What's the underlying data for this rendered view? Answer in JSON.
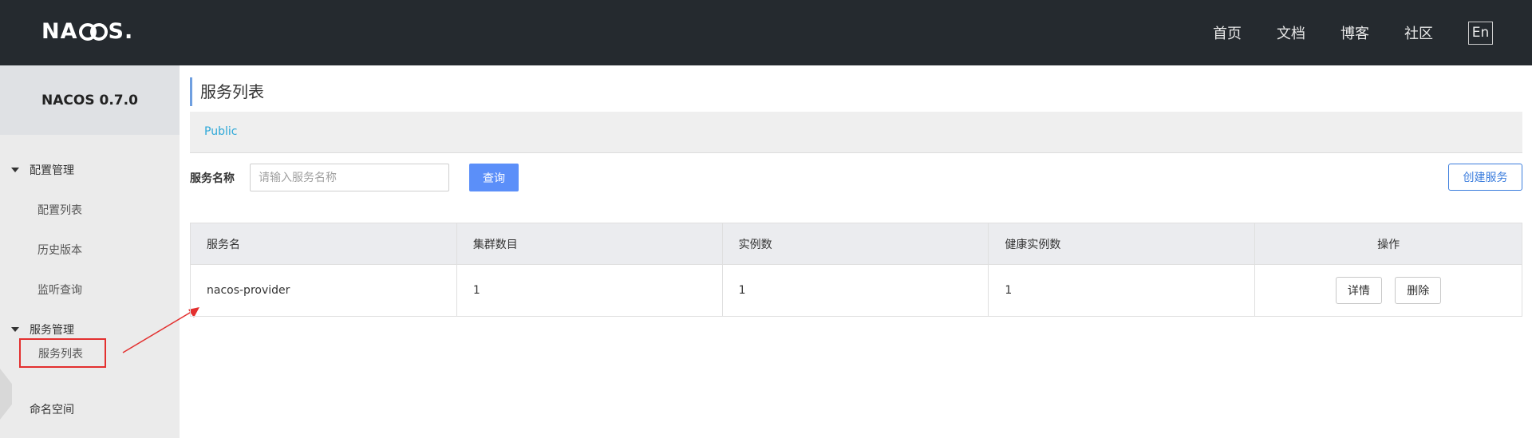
{
  "header": {
    "logo": "NACOS.",
    "nav": [
      "首页",
      "文档",
      "博客",
      "社区"
    ],
    "lang": "En"
  },
  "sidebar": {
    "title": "NACOS 0.7.0",
    "groups": [
      {
        "label": "配置管理",
        "items": [
          "配置列表",
          "历史版本",
          "监听查询"
        ]
      },
      {
        "label": "服务管理",
        "items": [
          "服务列表"
        ]
      }
    ],
    "extra_item": "命名空间"
  },
  "main": {
    "title": "服务列表",
    "namespace": "Public",
    "filter": {
      "label": "服务名称",
      "placeholder": "请输入服务名称",
      "query_label": "查询"
    },
    "create_label": "创建服务",
    "table": {
      "columns": [
        "服务名",
        "集群数目",
        "实例数",
        "健康实例数",
        "操作"
      ],
      "rows": [
        {
          "name": "nacos-provider",
          "clusters": "1",
          "instances": "1",
          "healthy": "1",
          "actions": [
            "详情",
            "删除"
          ]
        }
      ]
    }
  },
  "colors": {
    "header_bg": "#252a2f",
    "accent": "#5b8ff9",
    "annotation": "#e3302f",
    "namespace_link": "#2da8d8"
  }
}
